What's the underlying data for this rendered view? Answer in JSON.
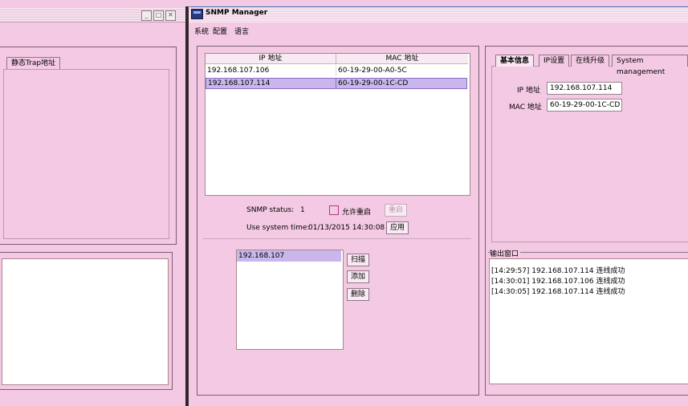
{
  "left_window": {
    "tab_label": "静态Trap地址"
  },
  "app": {
    "title": "SNMP Manager",
    "menu": [
      "系统",
      "配置",
      "语言"
    ]
  },
  "device_table": {
    "headers": [
      "IP 地址",
      "MAC 地址"
    ],
    "rows": [
      {
        "ip": "192.168.107.106",
        "mac": "60-19-29-00-A0-5C"
      },
      {
        "ip": "192.168.107.114",
        "mac": "60-19-29-00-1C-CD"
      }
    ],
    "selected_index": 1
  },
  "snmp": {
    "status_label": "SNMP status:",
    "status_value": "1",
    "allow_restart_label": "允许重启",
    "restart_button": "重启",
    "system_time_label": "Use system time:",
    "system_time_value": "01/13/2015 14:30:08",
    "apply_button": "应用"
  },
  "subnet_list": {
    "items": [
      "192.168.107"
    ],
    "scan_button": "扫描",
    "add_button": "添加",
    "delete_button": "删除"
  },
  "info_panel": {
    "tabs": [
      "基本信息",
      "IP设置",
      "在线升级",
      "System management"
    ],
    "ip_label": "IP 地址",
    "ip_value": "192.168.107.114",
    "mac_label": "MAC 地址",
    "mac_value": "60-19-29-00-1C-CD"
  },
  "output": {
    "title": "输出窗口",
    "lines": [
      "[14:29:57]  192.168.107.114 连线成功",
      "[14:30:01]  192.168.107.106 连线成功",
      "[14:30:05]  192.168.107.114 连线成功"
    ]
  }
}
